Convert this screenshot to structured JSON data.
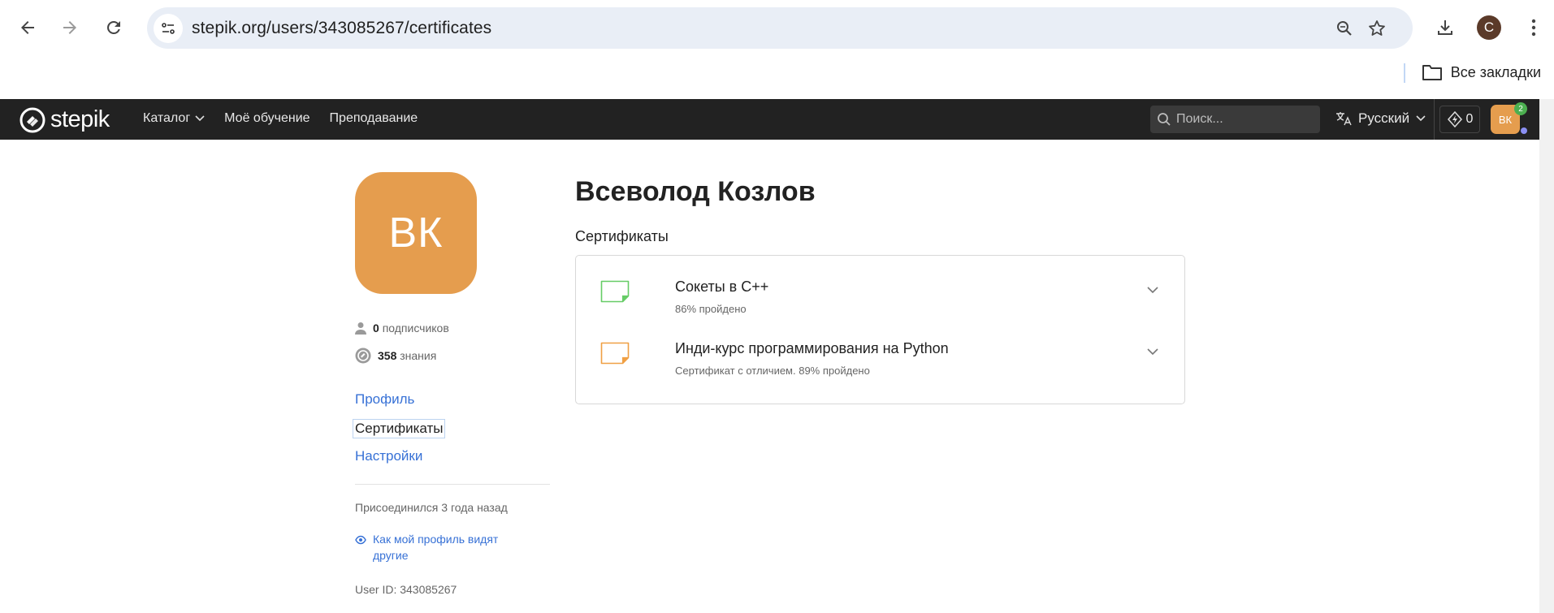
{
  "browser": {
    "url": "stepik.org/users/343085267/certificates",
    "profile_initial": "C",
    "bookmarks_label": "Все закладки"
  },
  "header": {
    "logo_text": "stepik",
    "menu": [
      {
        "label": "Каталог"
      },
      {
        "label": "Моё обучение"
      },
      {
        "label": "Преподавание"
      }
    ],
    "search_placeholder": "Поиск...",
    "language": "Русский",
    "energy_count": "0",
    "avatar_initials": "ВК",
    "notifications_count": "2"
  },
  "sidebar": {
    "avatar_initials": "ВК",
    "followers_count": "0",
    "followers_label": "подписчиков",
    "knowledge_count": "358",
    "knowledge_label": "знания",
    "links": [
      {
        "label": "Профиль"
      },
      {
        "label": "Сертификаты"
      },
      {
        "label": "Настройки"
      }
    ],
    "joined": "Присоединился 3 года назад",
    "visibility_link": "Как мой профиль видят другие",
    "user_id": "User ID: 343085267"
  },
  "main": {
    "user_name": "Всеволод Козлов",
    "section_title": "Сертификаты",
    "certificates": [
      {
        "title": "Сокеты в C++",
        "subtitle": "86% пройдено",
        "color": "#66cc66"
      },
      {
        "title": "Инди-курс программирования на Python",
        "subtitle": "Сертификат с отличием. 89% пройдено",
        "color": "#f0a044"
      }
    ]
  }
}
